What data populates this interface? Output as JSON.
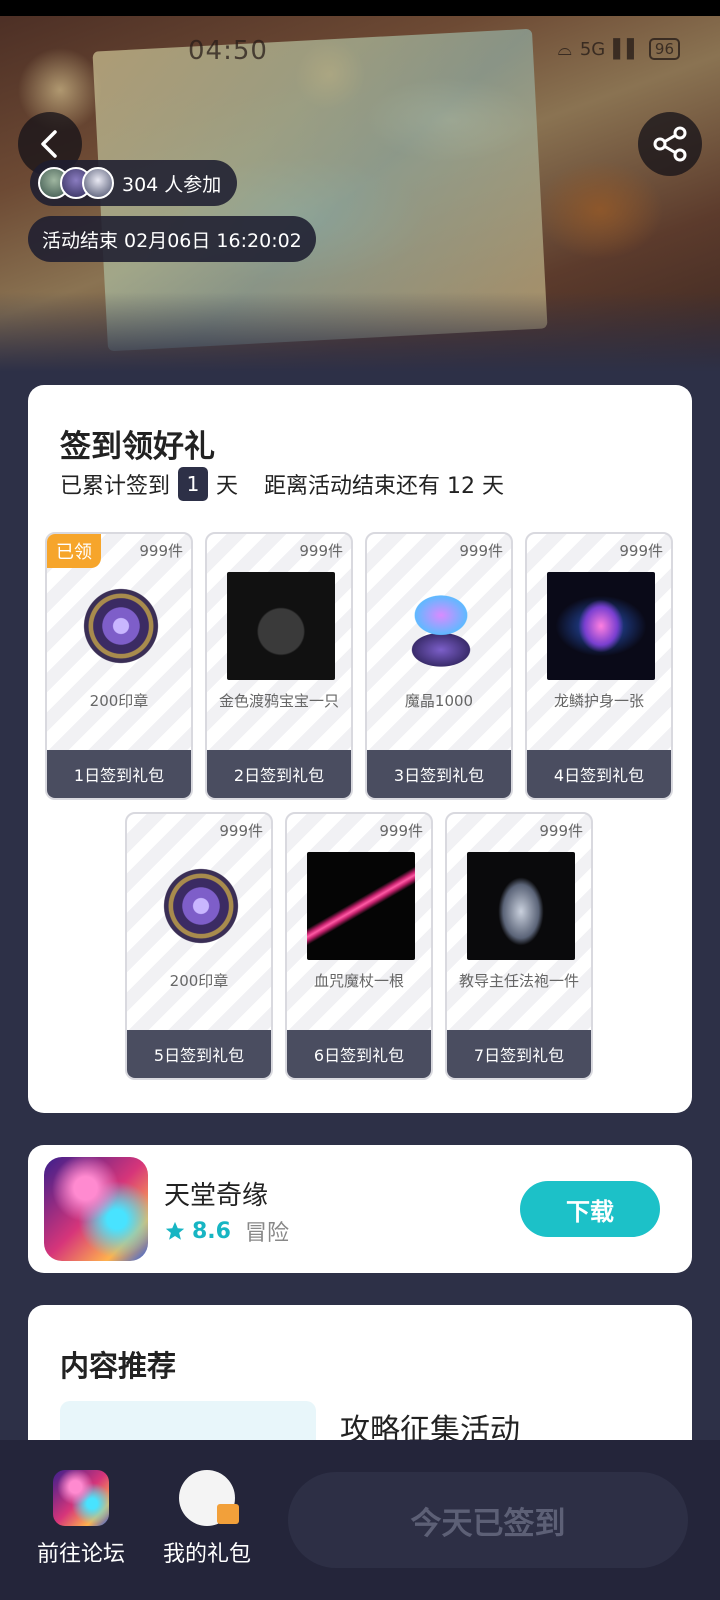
{
  "status_bar": {
    "time": "04:50",
    "network": "5G",
    "battery": "96"
  },
  "header": {
    "participants": "304 人参加",
    "end_time": "活动结束 02月06日 16:20:02"
  },
  "signin": {
    "title": "签到领好礼",
    "prefix": "已累计签到",
    "days": "1",
    "unit": "天",
    "remaining": "距离活动结束还有 12 天",
    "claimed_badge": "已领",
    "gifts": [
      {
        "quantity": "999件",
        "name": "200印章",
        "label": "1日签到礼包",
        "icon": "seal-icon",
        "claimed": true
      },
      {
        "quantity": "999件",
        "name": "金色渡鸦宝宝一只",
        "label": "2日签到礼包",
        "icon": "golden-crow-icon"
      },
      {
        "quantity": "999件",
        "name": "魔晶1000",
        "label": "3日签到礼包",
        "icon": "crystal-chest-icon"
      },
      {
        "quantity": "999件",
        "name": "龙鳞护身一张",
        "label": "4日签到礼包",
        "icon": "dragon-scale-icon"
      },
      {
        "quantity": "999件",
        "name": "200印章",
        "label": "5日签到礼包",
        "icon": "seal-icon"
      },
      {
        "quantity": "999件",
        "name": "血咒魔杖一根",
        "label": "6日签到礼包",
        "icon": "staff-icon"
      },
      {
        "quantity": "999件",
        "name": "教导主任法袍一件",
        "label": "7日签到礼包",
        "icon": "robe-icon"
      }
    ]
  },
  "app": {
    "name": "天堂奇缘",
    "rating": "8.6",
    "genre": "冒险",
    "download_label": "下载",
    "accent": "#1cc1c8"
  },
  "recommend": {
    "title": "内容推荐",
    "items": [
      {
        "title": "攻略征集活动"
      }
    ]
  },
  "bottom_bar": {
    "forum_label": "前往论坛",
    "gift_label": "我的礼包",
    "checkin_label": "今天已签到"
  }
}
